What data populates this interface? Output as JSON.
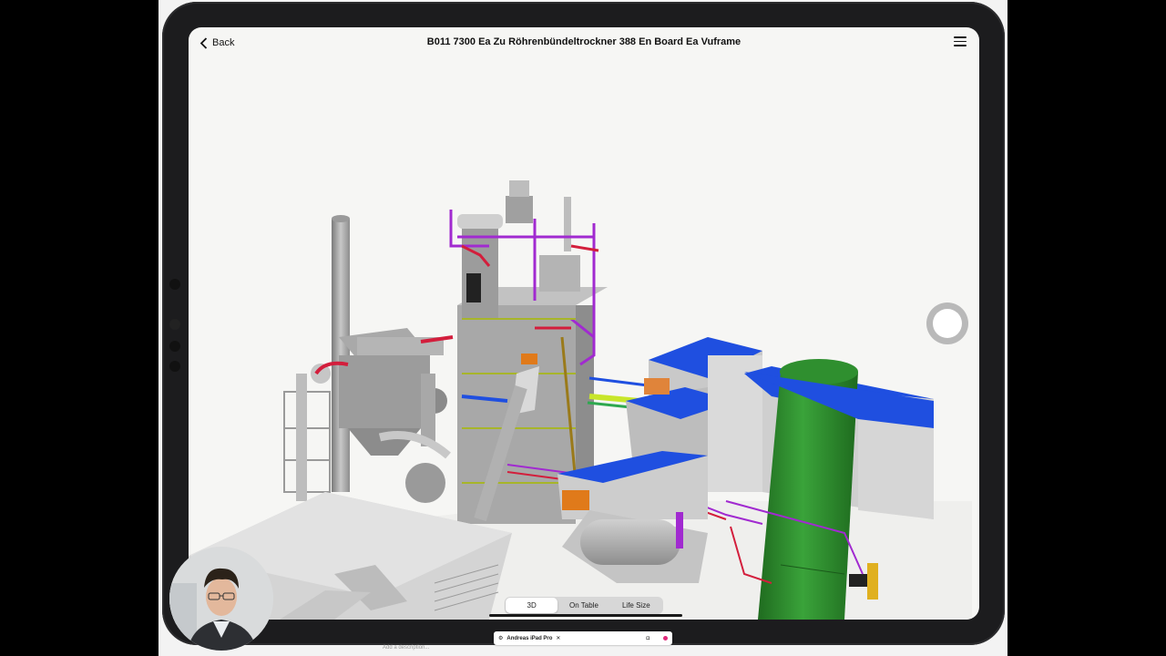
{
  "app": {
    "back_label": "Back",
    "title": "B011 7300 Ea Zu Röhrenbündeltrockner 388 En Board Ea Vuframe",
    "menu_icon": "hamburger-menu-icon",
    "back_icon": "chevron-left-icon"
  },
  "view_modes": {
    "items": [
      "3D",
      "On Table",
      "Life Size"
    ],
    "selected": "3D"
  },
  "capture_button": {
    "icon": "capture-circle-icon"
  },
  "bottom_bar": {
    "device_label": "Andreas iPad Pro",
    "close_glyph": "✕",
    "camera_icon": "camera-icon",
    "record_color": "#e0287a"
  },
  "bottom_hint": "Add a description...",
  "colors": {
    "roof_blue": "#1f4fe0",
    "silo_green": "#2e8f2e",
    "pipe_purple": "#a12ad0",
    "pipe_red": "#d31e3c",
    "pipe_yellow": "#c8e62a"
  }
}
